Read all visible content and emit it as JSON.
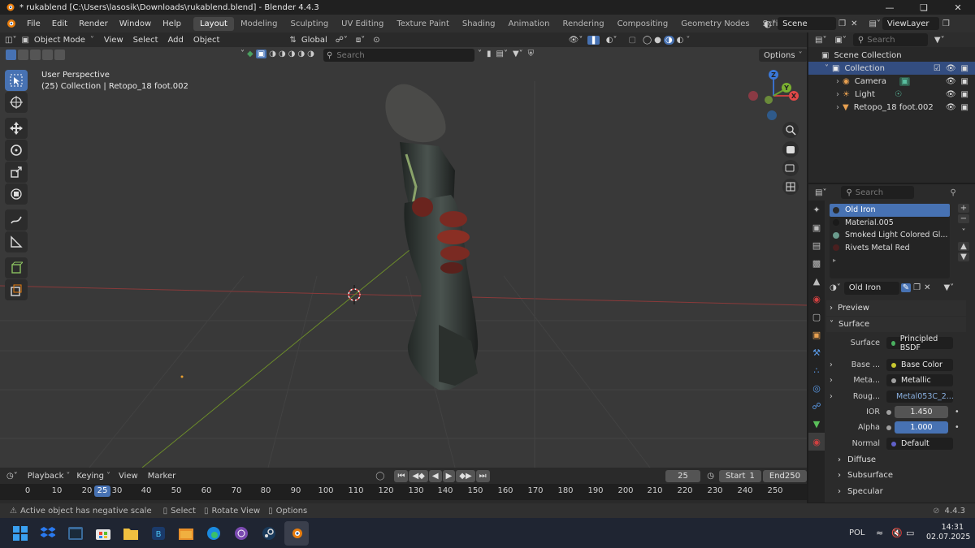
{
  "window": {
    "title": "* rukablend [C:\\Users\\lasosik\\Downloads\\rukablend.blend] - Blender 4.4.3",
    "controls": [
      "minimize",
      "maximize",
      "close"
    ]
  },
  "menu": {
    "items": [
      "File",
      "Edit",
      "Render",
      "Window",
      "Help"
    ]
  },
  "workspaces": {
    "tabs": [
      "Layout",
      "Modeling",
      "Sculpting",
      "UV Editing",
      "Texture Paint",
      "Shading",
      "Animation",
      "Rendering",
      "Compositing",
      "Geometry Nodes",
      "Scripting"
    ],
    "active": "Layout",
    "add_label": "+"
  },
  "scene": {
    "name": "Scene",
    "view_layer": "ViewLayer"
  },
  "viewport": {
    "mode": "Object Mode",
    "menus": [
      "View",
      "Select",
      "Add",
      "Object"
    ],
    "transform_orientation": "Global",
    "search_placeholder": "Search",
    "options_label": "Options",
    "info_line1": "User Perspective",
    "info_line2": "(25) Collection | Retopo_18 foot.002",
    "gizmo": {
      "z": "Z",
      "y": "Y",
      "x": "X"
    }
  },
  "outliner": {
    "search_placeholder": "Search",
    "root": "Scene Collection",
    "collection": "Collection",
    "items": [
      {
        "name": "Camera",
        "icon": "camera-icon"
      },
      {
        "name": "Light",
        "icon": "light-icon"
      },
      {
        "name": "Retopo_18 foot.002",
        "icon": "mesh-icon"
      }
    ]
  },
  "properties": {
    "search_placeholder": "Search",
    "material_slots": [
      {
        "name": "Old Iron",
        "color": "#2a2a2a",
        "selected": true
      },
      {
        "name": "Material.005",
        "color": "#1a1a1a",
        "selected": false
      },
      {
        "name": "Smoked Light Colored Gl...",
        "color": "#6a9a8c",
        "selected": false
      },
      {
        "name": "Rivets Metal Red",
        "color": "#4a1f1f",
        "selected": false
      }
    ],
    "material_name": "Old Iron",
    "sections": {
      "preview": "Preview",
      "surface": "Surface",
      "diffuse": "Diffuse",
      "subsurface": "Subsurface",
      "specular": "Specular"
    },
    "surface": {
      "surface_label": "Surface",
      "surface_value": "Principled BSDF",
      "base_label": "Base ...",
      "base_value": "Base Color",
      "metal_label": "Meta...",
      "metal_value": "Metallic",
      "rough_label": "Roug...",
      "rough_value": "Metal053C_2...",
      "ior_label": "IOR",
      "ior_value": "1.450",
      "alpha_label": "Alpha",
      "alpha_value": "1.000",
      "normal_label": "Normal",
      "normal_value": "Default"
    }
  },
  "timeline": {
    "menus": [
      "Playback",
      "Keying",
      "View",
      "Marker"
    ],
    "current_frame": "25",
    "start_label": "Start",
    "start_value": "1",
    "end_label": "End",
    "end_value": "250",
    "ruler": [
      "0",
      "10",
      "20",
      "30",
      "40",
      "50",
      "60",
      "70",
      "80",
      "90",
      "100",
      "110",
      "120",
      "130",
      "140",
      "150",
      "160",
      "170",
      "180",
      "190",
      "200",
      "210",
      "220",
      "230",
      "240",
      "250"
    ],
    "ruler_current": "25"
  },
  "status": {
    "message": "Active object has negative scale",
    "select": "Select",
    "rotate": "Rotate View",
    "options": "Options",
    "version": "4.4.3"
  },
  "taskbar": {
    "apps": [
      "start-icon",
      "dropbox-icon",
      "terminal-icon",
      "store-icon",
      "explorer-icon",
      "app-icon",
      "folder-icon",
      "edge-icon",
      "tor-icon",
      "steam-icon",
      "blender-icon"
    ],
    "language": "POL",
    "time": "14:31",
    "date": "02.07.2025"
  }
}
